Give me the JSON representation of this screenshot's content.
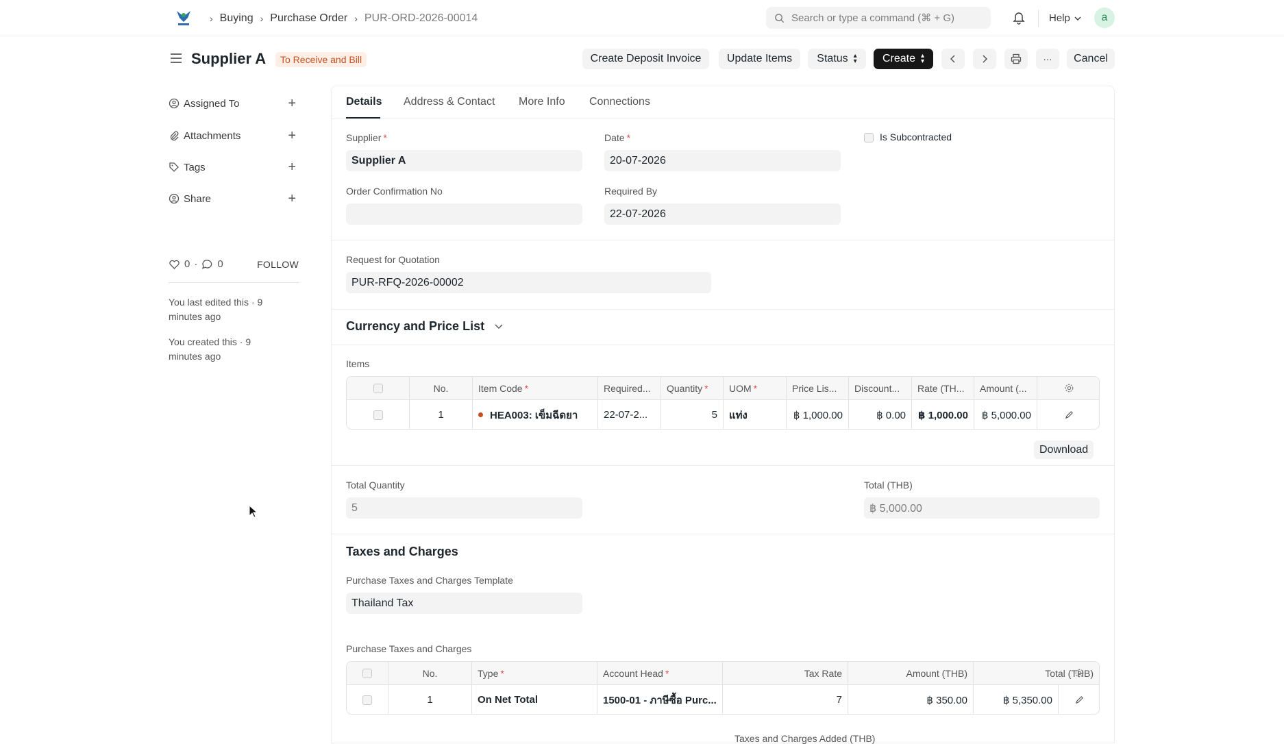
{
  "navbar": {
    "breadcrumbs": [
      "Buying",
      "Purchase Order",
      "PUR-ORD-2026-00014"
    ],
    "search_placeholder": "Search or type a command (⌘ + G)",
    "help_label": "Help",
    "avatar_initial": "a"
  },
  "header": {
    "title": "Supplier A",
    "status": "To Receive and Bill",
    "buttons": {
      "deposit": "Create Deposit Invoice",
      "update_items": "Update Items",
      "status": "Status",
      "create": "Create",
      "more": "···",
      "cancel": "Cancel"
    }
  },
  "sidebar": {
    "items": [
      {
        "label": "Assigned To",
        "icon": "assign-icon"
      },
      {
        "label": "Attachments",
        "icon": "paperclip-icon"
      },
      {
        "label": "Tags",
        "icon": "tag-icon"
      },
      {
        "label": "Share",
        "icon": "share-icon"
      }
    ],
    "likes": "0",
    "comments": "0",
    "follow": "FOLLOW",
    "last_edited": "You last edited this · 9 minutes ago",
    "created": "You created this · 9 minutes ago"
  },
  "tabs": [
    "Details",
    "Address & Contact",
    "More Info",
    "Connections"
  ],
  "details": {
    "supplier_label": "Supplier",
    "supplier_value": "Supplier A",
    "date_label": "Date",
    "date_value": "20-07-2026",
    "subcontracted_label": "Is Subcontracted",
    "order_conf_label": "Order Confirmation No",
    "order_conf_value": "",
    "required_by_label": "Required By",
    "required_by_value": "22-07-2026",
    "rfq_label": "Request for Quotation",
    "rfq_value": "PUR-RFQ-2026-00002"
  },
  "currency_section": "Currency and Price List",
  "items": {
    "label": "Items",
    "columns": [
      "No.",
      "Item Code",
      "Required...",
      "Quantity",
      "UOM",
      "Price Lis...",
      "Discount...",
      "Rate (TH...",
      "Amount (..."
    ],
    "rows": [
      {
        "no": "1",
        "item_code": "HEA003: เข็มฉีดยา",
        "required": "22-07-2...",
        "qty": "5",
        "uom": "แท่ง",
        "price_list": "฿ 1,000.00",
        "discount": "฿ 0.00",
        "rate": "฿ 1,000.00",
        "amount": "฿ 5,000.00"
      }
    ],
    "download": "Download"
  },
  "totals": {
    "qty_label": "Total Quantity",
    "qty_value": "5",
    "total_label": "Total (THB)",
    "total_value": "฿ 5,000.00"
  },
  "taxes": {
    "section": "Taxes and Charges",
    "template_label": "Purchase Taxes and Charges Template",
    "template_value": "Thailand Tax",
    "table_label": "Purchase Taxes and Charges",
    "columns": [
      "No.",
      "Type",
      "Account Head",
      "Tax Rate",
      "Amount (THB)",
      "Total (THB)"
    ],
    "rows": [
      {
        "no": "1",
        "type": "On Net Total",
        "account": "1500-01 - ภาษีซื้อ Purc...",
        "rate": "7",
        "amount": "฿ 350.00",
        "total": "฿ 5,350.00"
      }
    ],
    "added_label": "Taxes and Charges Added (THB)"
  }
}
